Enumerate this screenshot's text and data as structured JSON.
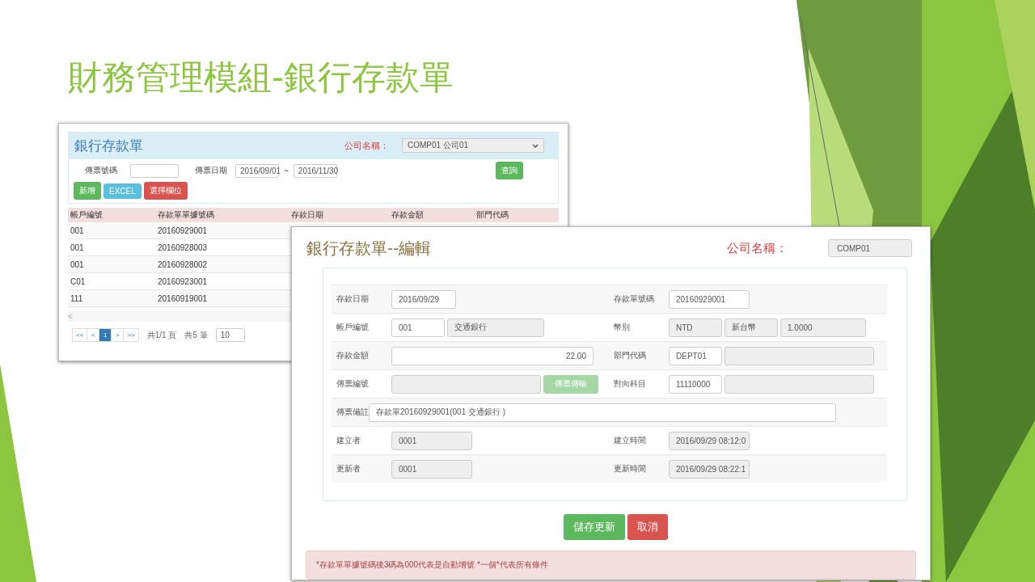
{
  "slide": {
    "title": "財務管理模組-銀行存款單"
  },
  "list_window": {
    "title": "銀行存款單",
    "company_label": "公司名稱：",
    "company_select": "COMP01 公司01",
    "filter": {
      "voucher_label": "傳票號碼",
      "date_label": "傳票日期",
      "date_from": "2016/09/01",
      "separator": "~",
      "date_to": "2016/11/30",
      "search_button": "查詢"
    },
    "buttons": [
      {
        "label": "新增",
        "kind": "success"
      },
      {
        "label": "EXCEL",
        "kind": "info"
      },
      {
        "label": "選擇欄位",
        "kind": "danger"
      }
    ],
    "table": {
      "columns": [
        "帳戶編號",
        "存款單單據號碼",
        "存款日期",
        "存款金額",
        "部門代碼"
      ],
      "rows": [
        [
          "001",
          "20160929001"
        ],
        [
          "001",
          "20160928003"
        ],
        [
          "001",
          "20160928002"
        ],
        [
          "C01",
          "20160923001"
        ],
        [
          "111",
          "20160919001"
        ]
      ]
    },
    "scroll_arrow": "<",
    "pagination": {
      "pages": [
        {
          "label": "<<",
          "selected": false
        },
        {
          "label": "<",
          "selected": false
        },
        {
          "label": "1",
          "selected": true
        },
        {
          "label": ">",
          "selected": false
        },
        {
          "label": ">>",
          "selected": false
        }
      ],
      "page_info": "共1/1 頁",
      "count": "共5 筆",
      "page_size": "10"
    }
  },
  "edit_window": {
    "title": "銀行存款單--編輯",
    "company_label": "公司名稱：",
    "company_value": "COMP01",
    "rows": [
      {
        "left": {
          "label": "存款日期",
          "fields": [
            {
              "kind": "input",
              "value": "2016/09/29"
            }
          ]
        },
        "right": {
          "label": "存款單號碼",
          "fields": [
            {
              "kind": "input",
              "value": "20160929001"
            }
          ]
        }
      },
      {
        "left": {
          "label": "帳戶編號",
          "fields": [
            {
              "kind": "input",
              "value": "001"
            },
            {
              "kind": "readonly",
              "value": "交通銀行"
            }
          ]
        },
        "right": {
          "label": "幣別",
          "fields": [
            {
              "kind": "readonly",
              "value": "NTD"
            },
            {
              "kind": "readonly",
              "value": "新台幣"
            },
            {
              "kind": "readonly",
              "value": "1.0000"
            }
          ]
        }
      },
      {
        "left": {
          "label": "存款金額",
          "fields": [
            {
              "kind": "number",
              "value": "22.00"
            }
          ]
        },
        "right": {
          "label": "部門代碼",
          "fields": [
            {
              "kind": "input",
              "value": "DEPT01"
            },
            {
              "kind": "readonly"
            }
          ]
        }
      },
      {
        "left": {
          "label": "傳票編號",
          "fields": [
            {
              "kind": "readonly"
            },
            {
              "kind": "button",
              "value": "傳票傳輸",
              "disabled": true
            }
          ]
        },
        "right": {
          "label": "對向科目",
          "fields": [
            {
              "kind": "input",
              "value": "11110000"
            },
            {
              "kind": "readonly"
            }
          ]
        }
      },
      {
        "left": {
          "label": "傳票備註",
          "fields": [
            {
              "kind": "input",
              "value": "存款單20160929001(001 交通銀行 )"
            }
          ]
        }
      },
      {
        "left": {
          "label": "建立者",
          "fields": [
            {
              "kind": "readonly",
              "value": "0001"
            }
          ]
        },
        "right": {
          "label": "建立時間",
          "fields": [
            {
              "kind": "readonly",
              "value": "2016/09/29 08:12:0"
            }
          ]
        }
      },
      {
        "left": {
          "label": "更新者",
          "fields": [
            {
              "kind": "readonly",
              "value": "0001"
            }
          ]
        },
        "right": {
          "label": "更新時間",
          "fields": [
            {
              "kind": "readonly",
              "value": "2016/09/29 08:22:1"
            }
          ]
        }
      }
    ],
    "buttons": [
      {
        "label": "儲存更新",
        "kind": "success"
      },
      {
        "label": "取消",
        "kind": "danger"
      }
    ],
    "note": "*存款單單據號碼後3碼為000代表是自動增號 *一個*代表所有條件"
  }
}
